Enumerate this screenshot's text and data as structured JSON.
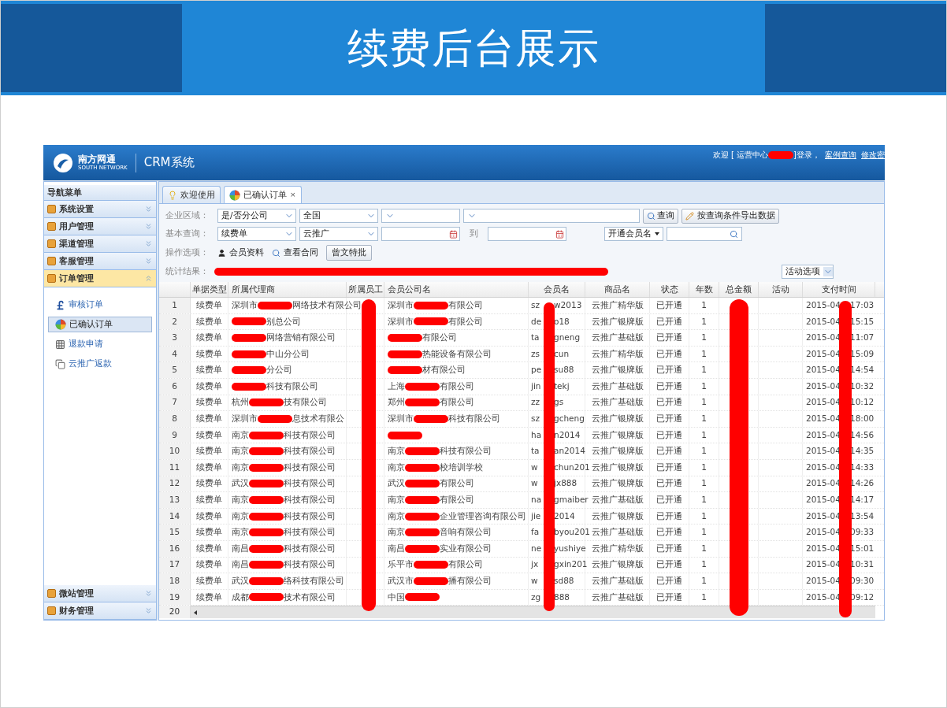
{
  "slide": {
    "title": "续费后台展示"
  },
  "app": {
    "logo_text": "南方网通",
    "logo_subtext": "SOUTH NETWORK",
    "name": "CRM系统",
    "welcome": {
      "before": "欢迎 [ 运营中心",
      "redacted": true,
      "after": "]登录，"
    },
    "links": [
      "案例查询",
      "修改密"
    ]
  },
  "sidebar": {
    "title": "导航菜单",
    "groups": [
      {
        "label": "系统设置",
        "expanded": false
      },
      {
        "label": "用户管理",
        "expanded": false
      },
      {
        "label": "渠道管理",
        "expanded": false
      },
      {
        "label": "客服管理",
        "expanded": false
      },
      {
        "label": "订单管理",
        "expanded": true,
        "children": [
          {
            "kind": "pound",
            "label": "审核订单",
            "selected": false
          },
          {
            "kind": "ball",
            "label": "已确认订单",
            "selected": true
          },
          {
            "kind": "grid",
            "label": "退款申请",
            "selected": false
          },
          {
            "kind": "pages",
            "label": "云推广返款",
            "selected": false
          }
        ]
      },
      {
        "label": "微站管理",
        "expanded": false
      },
      {
        "label": "财务管理",
        "expanded": false
      }
    ]
  },
  "tabs": [
    {
      "kind": "bulb",
      "label": "欢迎使用",
      "selected": false
    },
    {
      "kind": "ball",
      "label": "已确认订单",
      "selected": true,
      "close": "×"
    }
  ],
  "filters": {
    "region": {
      "label": "企业区域：",
      "selects": [
        {
          "value": "是/否分公司",
          "wide": false
        },
        {
          "value": "全国",
          "wide": false
        },
        {
          "wide": false
        },
        {
          "wide": true
        }
      ],
      "query_button": "查询",
      "export_button": "按查询条件导出数据"
    },
    "basic": {
      "label": "基本查询：",
      "selects": [
        "续费单",
        "云推广"
      ],
      "to": "到",
      "member_dropdown": "开通会员名"
    },
    "actions": {
      "label": "操作选项：",
      "items": [
        {
          "kind": "person",
          "label": "会员资料"
        },
        {
          "kind": "search",
          "label": "查看合同"
        }
      ],
      "button": "曾文特批"
    },
    "stats": {
      "label": "统计结果：",
      "redacted": true,
      "activity_select": "活动选项"
    }
  },
  "table": {
    "columns": [
      "单据类型",
      "所属代理商",
      "所属员工",
      "会员公司名",
      "会员名",
      "商品名",
      "状态",
      "年数",
      "总金额",
      "活动",
      "支付时间"
    ],
    "rows": [
      {
        "num": "1",
        "type": "续费单",
        "agent": {
          "before": "深圳市",
          "redacted": true,
          "after": "网络技术有限公司"
        },
        "company": {
          "before": "深圳市",
          "redacted": true,
          "after": "有限公司"
        },
        "member": [
          "sz",
          "w2013"
        ],
        "product": "云推广精华版",
        "status": "已开通",
        "years": "1",
        "time": [
          "2015-04",
          "17:03"
        ]
      },
      {
        "num": "2",
        "type": "续费单",
        "agent": {
          "redacted": true,
          "after": "别总公司"
        },
        "company": {
          "before": "深圳市",
          "redacted": true,
          "after": "有限公司"
        },
        "member": [
          "de",
          "o18"
        ],
        "product": "云推广银牌版",
        "status": "已开通",
        "years": "1",
        "time": [
          "2015-04",
          "15:15"
        ]
      },
      {
        "num": "3",
        "type": "续费单",
        "agent": {
          "redacted": true,
          "after": "网络营销有限公司"
        },
        "company": {
          "redacted": true,
          "after": "有限公司"
        },
        "member": [
          "ta",
          "gneng"
        ],
        "product": "云推广基础版",
        "status": "已开通",
        "years": "1",
        "time": [
          "2015-04",
          "11:07"
        ]
      },
      {
        "num": "4",
        "type": "续费单",
        "agent": {
          "redacted": true,
          "after": "中山分公司"
        },
        "company": {
          "redacted": true,
          "after": "热能设备有限公司"
        },
        "member": [
          "zs",
          "cun"
        ],
        "product": "云推广精华版",
        "status": "已开通",
        "years": "1",
        "time": [
          "2015-04",
          "15:09"
        ]
      },
      {
        "num": "5",
        "type": "续费单",
        "agent": {
          "redacted": true,
          "after": "分公司"
        },
        "company": {
          "redacted": true,
          "after": "材有限公司"
        },
        "member": [
          "pe",
          "su88"
        ],
        "product": "云推广银牌版",
        "status": "已开通",
        "years": "1",
        "time": [
          "2015-04",
          "14:54"
        ]
      },
      {
        "num": "6",
        "type": "续费单",
        "agent": {
          "redacted": true,
          "after": "科技有限公司"
        },
        "company": {
          "before": "上海",
          "redacted": true,
          "after": "有限公司"
        },
        "member": [
          "jin",
          "tekj"
        ],
        "product": "云推广基础版",
        "status": "已开通",
        "years": "1",
        "time": [
          "2015-04",
          "10:32"
        ]
      },
      {
        "num": "7",
        "type": "续费单",
        "agent": {
          "before": "杭州",
          "redacted": true,
          "after": "技有限公司"
        },
        "company": {
          "before": "郑州",
          "redacted": true,
          "after": "有限公司"
        },
        "member": [
          "zz",
          "gs"
        ],
        "product": "云推广基础版",
        "status": "已开通",
        "years": "1",
        "time": [
          "2015-04",
          "10:12"
        ]
      },
      {
        "num": "8",
        "type": "续费单",
        "agent": {
          "before": "深圳市",
          "redacted": true,
          "after": "息技术有限公"
        },
        "company": {
          "before": "深圳市",
          "redacted": true,
          "after": "科技有限公司"
        },
        "member": [
          "sz",
          "gcheng"
        ],
        "product": "云推广银牌版",
        "status": "已开通",
        "years": "1",
        "time": [
          "2015-04",
          "18:00"
        ]
      },
      {
        "num": "9",
        "type": "续费单",
        "agent": {
          "before": "南京",
          "redacted": true,
          "after": "科技有限公司"
        },
        "company": {
          "redacted": true
        },
        "member": [
          "ha",
          "n2014"
        ],
        "product": "云推广银牌版",
        "status": "已开通",
        "years": "1",
        "time": [
          "2015-04",
          "14:56"
        ]
      },
      {
        "num": "10",
        "type": "续费单",
        "agent": {
          "before": "南京",
          "redacted": true,
          "after": "科技有限公司"
        },
        "company": {
          "before": "南京",
          "redacted": true,
          "after": "科技有限公司"
        },
        "member": [
          "ta",
          "an2014"
        ],
        "product": "云推广银牌版",
        "status": "已开通",
        "years": "1",
        "time": [
          "2015-04",
          "14:35"
        ]
      },
      {
        "num": "11",
        "type": "续费单",
        "agent": {
          "before": "南京",
          "redacted": true,
          "after": "科技有限公司"
        },
        "company": {
          "before": "南京",
          "redacted": true,
          "after": "校培训学校"
        },
        "member": [
          "w",
          "chun201"
        ],
        "product": "云推广银牌版",
        "status": "已开通",
        "years": "1",
        "time": [
          "2015-04",
          "14:33"
        ]
      },
      {
        "num": "12",
        "type": "续费单",
        "agent": {
          "before": "武汉",
          "redacted": true,
          "after": "科技有限公司"
        },
        "company": {
          "before": "武汉",
          "redacted": true,
          "after": "有限公司"
        },
        "member": [
          "w",
          "jx888"
        ],
        "product": "云推广银牌版",
        "status": "已开通",
        "years": "1",
        "time": [
          "2015-04",
          "14:26"
        ]
      },
      {
        "num": "13",
        "type": "续费单",
        "agent": {
          "before": "南京",
          "redacted": true,
          "after": "科技有限公司"
        },
        "company": {
          "before": "南京",
          "redacted": true,
          "after": "有限公司"
        },
        "member": [
          "na",
          "gmaiber"
        ],
        "product": "云推广基础版",
        "status": "已开通",
        "years": "1",
        "time": [
          "2015-04",
          "14:17"
        ]
      },
      {
        "num": "14",
        "type": "续费单",
        "agent": {
          "before": "南京",
          "redacted": true,
          "after": "科技有限公司"
        },
        "company": {
          "before": "南京",
          "redacted": true,
          "after": "企业管理咨询有限公司"
        },
        "member": [
          "jie",
          "2014"
        ],
        "product": "云推广银牌版",
        "status": "已开通",
        "years": "1",
        "time": [
          "2015-04",
          "13:54"
        ]
      },
      {
        "num": "15",
        "type": "续费单",
        "agent": {
          "before": "南京",
          "redacted": true,
          "after": "科技有限公司"
        },
        "company": {
          "before": "南京",
          "redacted": true,
          "after": "音响有限公司"
        },
        "member": [
          "fa",
          "byou201"
        ],
        "product": "云推广基础版",
        "status": "已开通",
        "years": "1",
        "time": [
          "2015-04",
          "09:33"
        ]
      },
      {
        "num": "16",
        "type": "续费单",
        "agent": {
          "before": "南昌",
          "redacted": true,
          "after": "科技有限公司"
        },
        "company": {
          "before": "南昌",
          "redacted": true,
          "after": "实业有限公司"
        },
        "member": [
          "ne",
          "yushiye"
        ],
        "product": "云推广精华版",
        "status": "已开通",
        "years": "1",
        "time": [
          "2015-04",
          "15:01"
        ]
      },
      {
        "num": "17",
        "type": "续费单",
        "agent": {
          "before": "南昌",
          "redacted": true,
          "after": "科技有限公司"
        },
        "company": {
          "before": "乐平市",
          "redacted": true,
          "after": "有限公司"
        },
        "member": [
          "jx",
          "gxin201"
        ],
        "product": "云推广银牌版",
        "status": "已开通",
        "years": "1",
        "time": [
          "2015-04",
          "10:31"
        ]
      },
      {
        "num": "18",
        "type": "续费单",
        "agent": {
          "before": "武汉",
          "redacted": true,
          "after": "络科技有限公司"
        },
        "company": {
          "before": "武汉市",
          "redacted": true,
          "after": "播有限公司"
        },
        "member": [
          "w",
          "sd88"
        ],
        "product": "云推广基础版",
        "status": "已开通",
        "years": "1",
        "time": [
          "2015-04",
          "09:30"
        ]
      },
      {
        "num": "19",
        "type": "续费单",
        "agent": {
          "before": "成都",
          "redacted": true,
          "after": "技术有限公司"
        },
        "company": {
          "before": "中国",
          "redacted": true
        },
        "member": [
          "zg",
          "888"
        ],
        "product": "云推广基础版",
        "status": "已开通",
        "years": "1",
        "time": [
          "2015-04",
          "09:12"
        ]
      }
    ],
    "last_row_num": "20"
  }
}
